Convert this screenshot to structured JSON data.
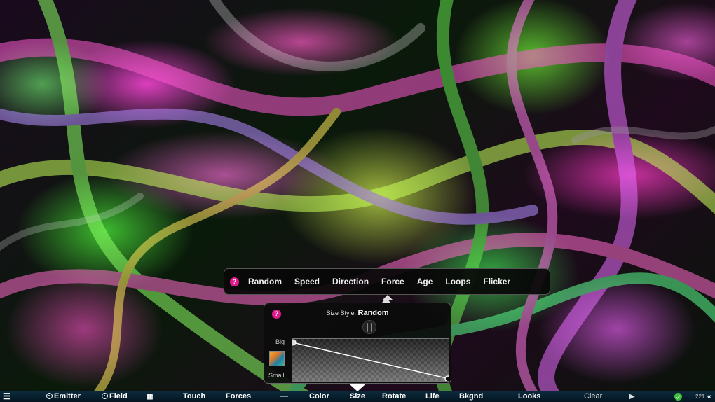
{
  "style_bar": {
    "options": [
      "Random",
      "Speed",
      "Direction",
      "Force",
      "Age",
      "Loops",
      "Flicker"
    ],
    "selected": "Force"
  },
  "size_panel": {
    "title_prefix": "Size Style:",
    "title_value": "Random",
    "label_big": "Big",
    "label_small": "Small",
    "curve_start": 1.0,
    "curve_end": 0.0
  },
  "toolbar": {
    "emitter": "Emitter",
    "field": "Field",
    "touch": "Touch",
    "forces": "Forces",
    "color": "Color",
    "size": "Size",
    "rotate": "Rotate",
    "life": "Life",
    "bkgnd": "Bkgnd",
    "looks": "Looks",
    "clear": "Clear",
    "fps": "221"
  },
  "colors": {
    "help_accent": "#e0198c",
    "toolbar_bg": "#0c2a3c",
    "status_ok": "#3cbf3c"
  }
}
